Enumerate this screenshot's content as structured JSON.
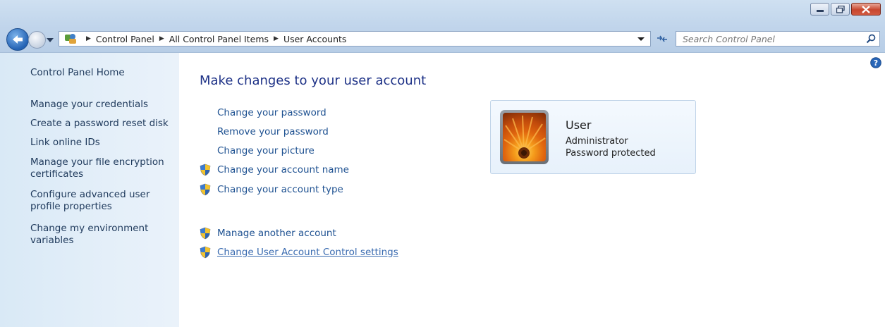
{
  "window": {
    "controls": [
      "minimize-icon",
      "restore-icon",
      "close-icon"
    ]
  },
  "addressbar": {
    "crumbs": [
      "Control Panel",
      "All Control Panel Items",
      "User Accounts"
    ]
  },
  "search": {
    "placeholder": "Search Control Panel"
  },
  "sidebar": {
    "items": [
      {
        "label": "Control Panel Home"
      },
      {
        "label": "Manage your credentials"
      },
      {
        "label": "Create a password reset disk"
      },
      {
        "label": "Link online IDs"
      },
      {
        "label": "Manage your file encryption certificates"
      },
      {
        "label": "Configure advanced user profile properties"
      },
      {
        "label": "Change my environment variables"
      }
    ]
  },
  "main": {
    "title": "Make changes to your user account",
    "tasks": [
      {
        "label": "Change your password",
        "shield": false
      },
      {
        "label": "Remove your password",
        "shield": false
      },
      {
        "label": "Change your picture",
        "shield": false
      },
      {
        "label": "Change your account name",
        "shield": true
      },
      {
        "label": "Change your account type",
        "shield": true
      }
    ],
    "more_tasks": [
      {
        "label": "Manage another account",
        "shield": true
      },
      {
        "label": "Change User Account Control settings",
        "shield": true,
        "hovered": true
      }
    ]
  },
  "account": {
    "name": "User",
    "type": "Administrator",
    "status": "Password protected"
  },
  "colors": {
    "link": "#1e5191",
    "title": "#1e3287",
    "sidebar_bg": "#e4eff9"
  }
}
